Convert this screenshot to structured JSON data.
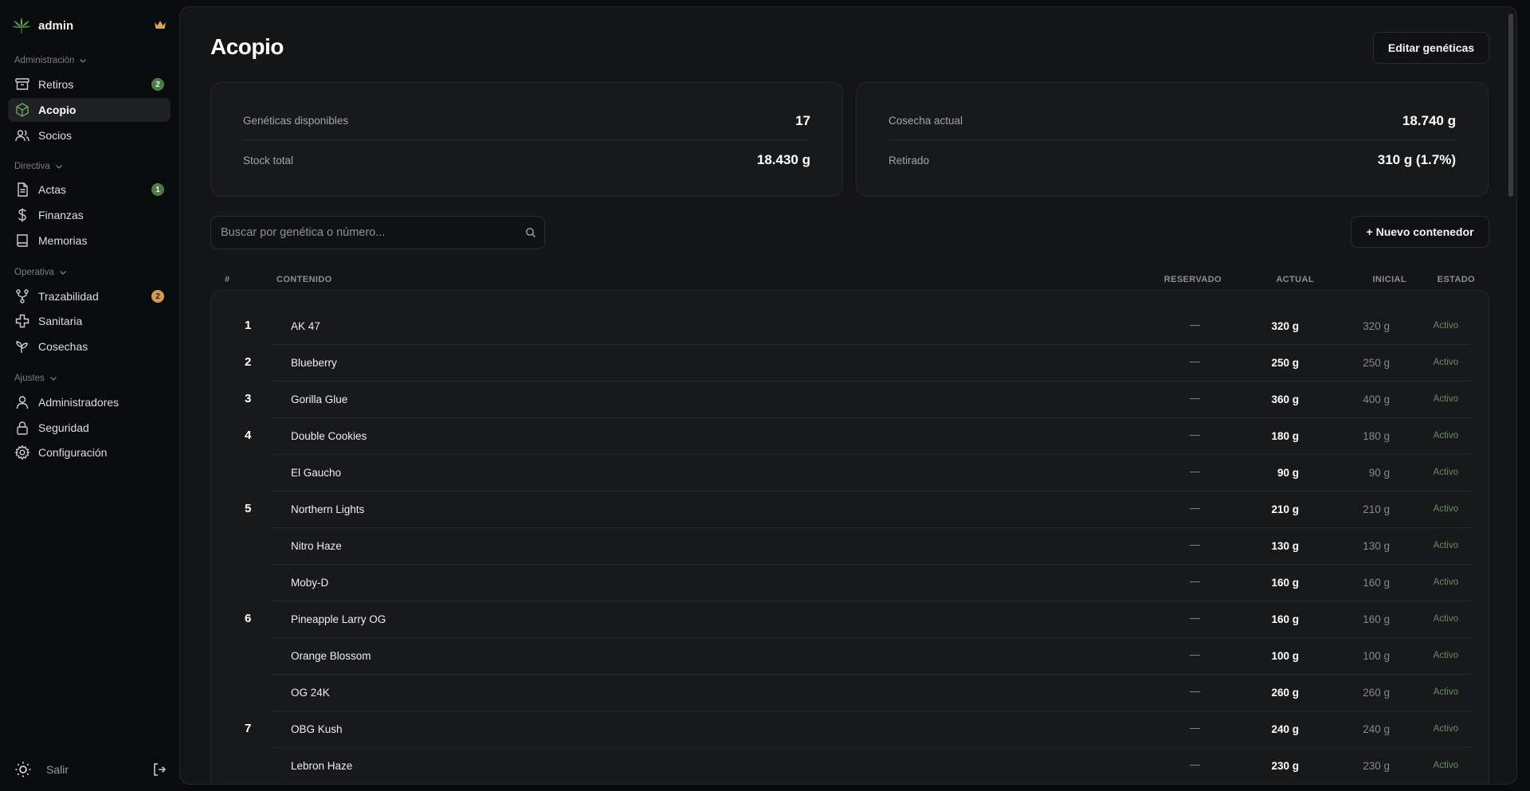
{
  "sidebar": {
    "user": "admin",
    "sections": [
      {
        "label": "Administración",
        "items": [
          {
            "label": "Retiros",
            "icon": "archive-icon",
            "badge": "2",
            "badge_color": "green"
          },
          {
            "label": "Acopio",
            "icon": "box-icon",
            "active": true
          },
          {
            "label": "Socios",
            "icon": "users-icon"
          }
        ]
      },
      {
        "label": "Directiva",
        "items": [
          {
            "label": "Actas",
            "icon": "file-text-icon",
            "badge": "1",
            "badge_color": "green"
          },
          {
            "label": "Finanzas",
            "icon": "dollar-icon"
          },
          {
            "label": "Memorias",
            "icon": "book-icon"
          }
        ]
      },
      {
        "label": "Operativa",
        "items": [
          {
            "label": "Trazabilidad",
            "icon": "git-branch-icon",
            "badge": "2",
            "badge_color": "amber"
          },
          {
            "label": "Sanitaria",
            "icon": "cross-icon"
          },
          {
            "label": "Cosechas",
            "icon": "sprout-icon"
          }
        ]
      },
      {
        "label": "Ajustes",
        "items": [
          {
            "label": "Administradores",
            "icon": "user-icon"
          },
          {
            "label": "Seguridad",
            "icon": "lock-icon"
          },
          {
            "label": "Configuración",
            "icon": "gear-icon"
          }
        ]
      }
    ],
    "footer": {
      "logout_label": "Salir"
    }
  },
  "header": {
    "title": "Acopio",
    "edit_button": "Editar genéticas"
  },
  "stats": {
    "left": [
      {
        "label": "Genéticas disponibles",
        "value": "17"
      },
      {
        "label": "Stock total",
        "value": "18.430 g"
      }
    ],
    "right": [
      {
        "label": "Cosecha actual",
        "value": "18.740 g"
      },
      {
        "label": "Retirado",
        "value": "310 g (1.7%)"
      }
    ]
  },
  "search": {
    "placeholder": "Buscar por genética o número..."
  },
  "new_container_button": "+ Nuevo contenedor",
  "table": {
    "headers": {
      "num": "#",
      "contenido": "CONTENIDO",
      "reservado": "RESERVADO",
      "actual": "ACTUAL",
      "inicial": "INICIAL",
      "estado": "ESTADO"
    },
    "rows": [
      {
        "group": "1",
        "name": "AK 47",
        "reservado": "—",
        "actual": "320 g",
        "inicial": "320 g",
        "estado": "Activo"
      },
      {
        "group": "2",
        "name": "Blueberry",
        "reservado": "—",
        "actual": "250 g",
        "inicial": "250 g",
        "estado": "Activo"
      },
      {
        "group": "3",
        "name": "Gorilla Glue",
        "reservado": "—",
        "actual": "360 g",
        "inicial": "400 g",
        "estado": "Activo"
      },
      {
        "group": "4",
        "name": "Double Cookies",
        "reservado": "—",
        "actual": "180 g",
        "inicial": "180 g",
        "estado": "Activo"
      },
      {
        "group": "",
        "name": "El Gaucho",
        "reservado": "—",
        "actual": "90 g",
        "inicial": "90 g",
        "estado": "Activo"
      },
      {
        "group": "5",
        "name": "Northern Lights",
        "reservado": "—",
        "actual": "210 g",
        "inicial": "210 g",
        "estado": "Activo"
      },
      {
        "group": "",
        "name": "Nitro Haze",
        "reservado": "—",
        "actual": "130 g",
        "inicial": "130 g",
        "estado": "Activo"
      },
      {
        "group": "",
        "name": "Moby-D",
        "reservado": "—",
        "actual": "160 g",
        "inicial": "160 g",
        "estado": "Activo"
      },
      {
        "group": "6",
        "name": "Pineapple Larry OG",
        "reservado": "—",
        "actual": "160 g",
        "inicial": "160 g",
        "estado": "Activo"
      },
      {
        "group": "",
        "name": "Orange Blossom",
        "reservado": "—",
        "actual": "100 g",
        "inicial": "100 g",
        "estado": "Activo"
      },
      {
        "group": "",
        "name": "OG 24K",
        "reservado": "—",
        "actual": "260 g",
        "inicial": "260 g",
        "estado": "Activo"
      },
      {
        "group": "7",
        "name": "OBG Kush",
        "reservado": "—",
        "actual": "240 g",
        "inicial": "240 g",
        "estado": "Activo"
      },
      {
        "group": "",
        "name": "Lebron Haze",
        "reservado": "—",
        "actual": "230 g",
        "inicial": "230 g",
        "estado": "Activo"
      }
    ]
  },
  "colors": {
    "accent_green": "#4e7a46",
    "badge_amber": "#d39a52",
    "status_green": "#6c8a62",
    "panel": "#141517",
    "background": "#0a0b0d"
  }
}
